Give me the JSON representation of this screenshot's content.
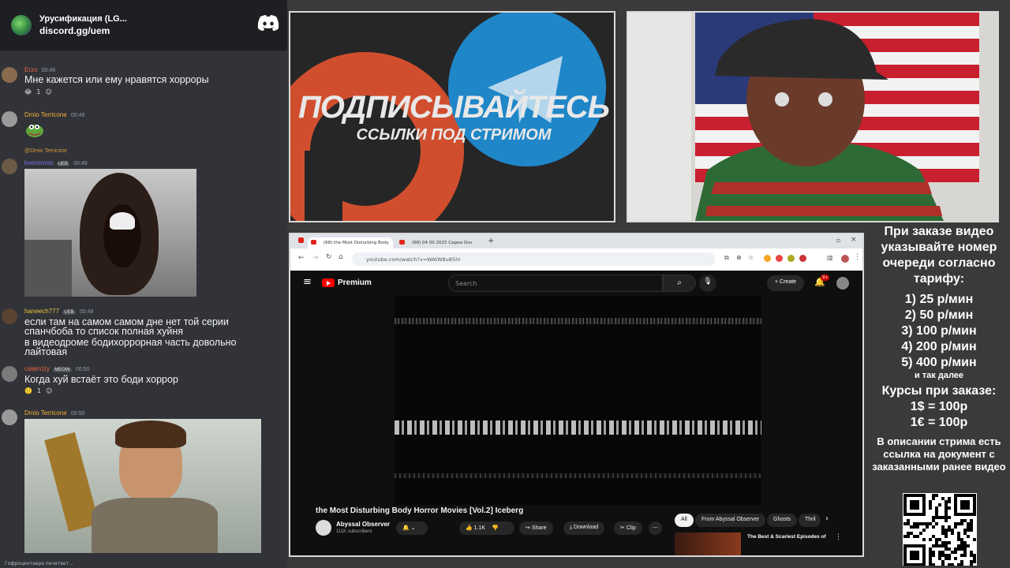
{
  "chat": {
    "server_name": "Урусификация (LG...",
    "server_link": "discord.gg/uem",
    "messages": [
      {
        "user": "Erzo",
        "time": "00:48",
        "text": "Мне кажется или ему нравятся хорроры",
        "reaction_count": "1",
        "color": "#e8643c"
      },
      {
        "user": "Dmio Terricone",
        "time": "00:49",
        "text": "",
        "color": "#f0b232"
      },
      {
        "user": "kvencmoo",
        "time": "00:49",
        "reply_to": "@Dmio Terricone",
        "badge": "UEB",
        "text": "",
        "color": "#7c73e6"
      },
      {
        "user": "haneech777",
        "time": "00:49",
        "badge": "UEB",
        "lines": [
          "если там на самом самом дне нет той серии",
          "спанчбоба то список полная хуйня",
          "в видеодроме бодихоррорная часть довольно",
          "лайтовая"
        ],
        "color": "#e8c440"
      },
      {
        "user": "calam1ty",
        "time": "00:50",
        "badge": "MEOW",
        "text": "Когда хуй встаёт это боди хоррор",
        "reaction_count": "1",
        "color": "#e8643c"
      },
      {
        "user": "Dmio Terricone",
        "time": "00:50",
        "text": "",
        "color": "#f0b232"
      }
    ],
    "typing": "Гофроцентавра печатает..."
  },
  "promo": {
    "line1": "ПОДПИСЫВАЙТЕСЬ",
    "line2": "ССЫЛКИ ПОД СТРИМОМ"
  },
  "info": {
    "header": "При заказе видео указывайте номер очереди согласно тарифу:",
    "tariffs": [
      "1) 25 р/мин",
      "2) 50 р/мин",
      "3) 100 р/мин",
      "4) 200 р/мин",
      "5) 400 р/мин"
    ],
    "and_more": "и так далее",
    "rates_title": "Курсы при заказе:",
    "rates": [
      "1$ = 100р",
      "1€ = 100р"
    ],
    "note": "В описании стрима есть ссылка на документ с заказанными ранее видео"
  },
  "browser": {
    "tabs": [
      "(68) the Most Disturbing Body",
      "(68) 04 00 2025 Серия Осн"
    ],
    "url": "youtube.com/watch?v=WAtW8u85hI",
    "youtube": {
      "logo_text": "Premium",
      "search_placeholder": "Search",
      "create_label": "Create",
      "notif_count": "9+",
      "video_title": "the Most Disturbing Body Horror Movies [Vol.2] Iceberg",
      "channel": "Abyssal Observer",
      "subscribers": "111K subscribers",
      "likes": "1.1K",
      "share": "Share",
      "download": "Download",
      "clip": "Clip",
      "chips": [
        "All",
        "From Abyssal Observer",
        "Ghosts",
        "Thril"
      ],
      "rec_title": "The Best & Scariest Episodes of"
    }
  }
}
